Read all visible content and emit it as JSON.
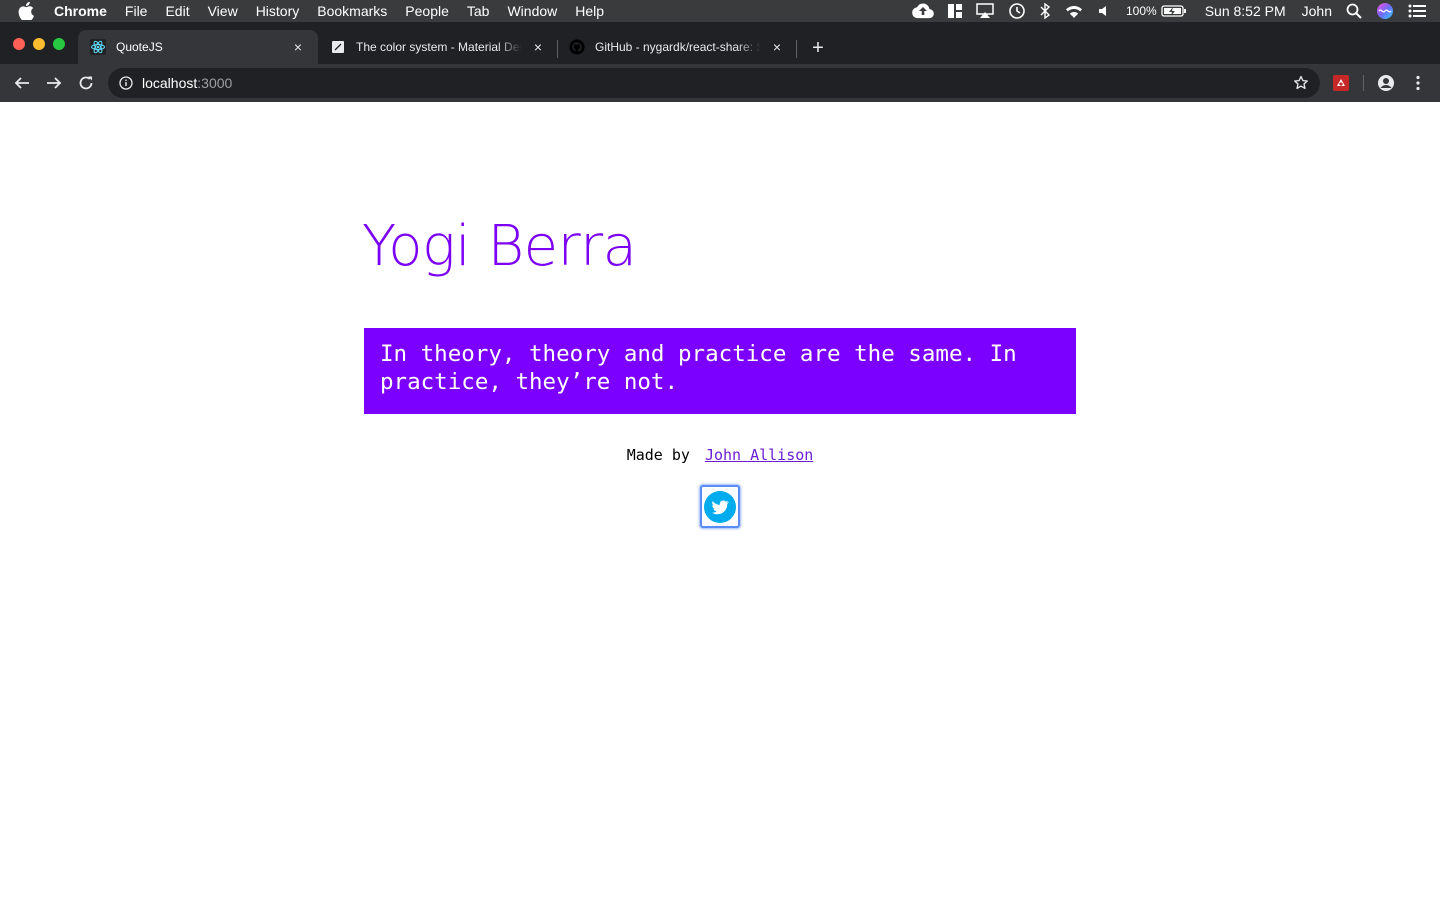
{
  "menubar": {
    "app": "Chrome",
    "items": [
      "File",
      "Edit",
      "View",
      "History",
      "Bookmarks",
      "People",
      "Tab",
      "Window",
      "Help"
    ],
    "battery": "100%",
    "clock": "Sun 8:52 PM",
    "user": "John"
  },
  "tabs": [
    {
      "title": "QuoteJS",
      "close": "×"
    },
    {
      "title": "The color system - Material Design",
      "close": "×"
    },
    {
      "title": "GitHub - nygardk/react-share: Social media share buttons",
      "close": "×"
    }
  ],
  "newtab": "+",
  "address": {
    "host": "localhost",
    "port": ":3000"
  },
  "quote": {
    "author": "Yogi Berra",
    "text": "In theory, theory and practice are the same. In practice, they’re not."
  },
  "footer": {
    "prefix": "Made by",
    "link": "John Allison"
  },
  "colors": {
    "accent": "#7b00ff",
    "author": "#7b00f5",
    "twitter": "#00aced"
  }
}
